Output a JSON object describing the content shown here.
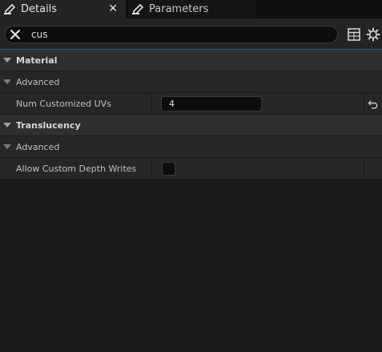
{
  "tabs": {
    "details_label": "Details",
    "parameters_label": "Parameters",
    "close_glyph": "✕"
  },
  "search": {
    "value": "cus"
  },
  "sections": {
    "material": {
      "title": "Material",
      "advanced": "Advanced",
      "num_customized_uvs_label": "Num Customized UVs",
      "num_customized_uvs_value": "4"
    },
    "translucency": {
      "title": "Translucency",
      "advanced": "Advanced",
      "allow_custom_depth_writes_label": "Allow Custom Depth Writes",
      "allow_custom_depth_writes_checked": false
    }
  },
  "icons": {
    "details_tab": "details-pencil-icon",
    "parameters_tab": "parameters-pencil-icon",
    "clear_search": "close-icon",
    "table_view": "table-icon",
    "settings": "gear-icon",
    "reset": "reset-arrow-icon"
  },
  "colors": {
    "accent": "#1f5f9a",
    "background": "#1a1a1a",
    "panel": "#242424",
    "category_row": "#2f2f2f"
  }
}
